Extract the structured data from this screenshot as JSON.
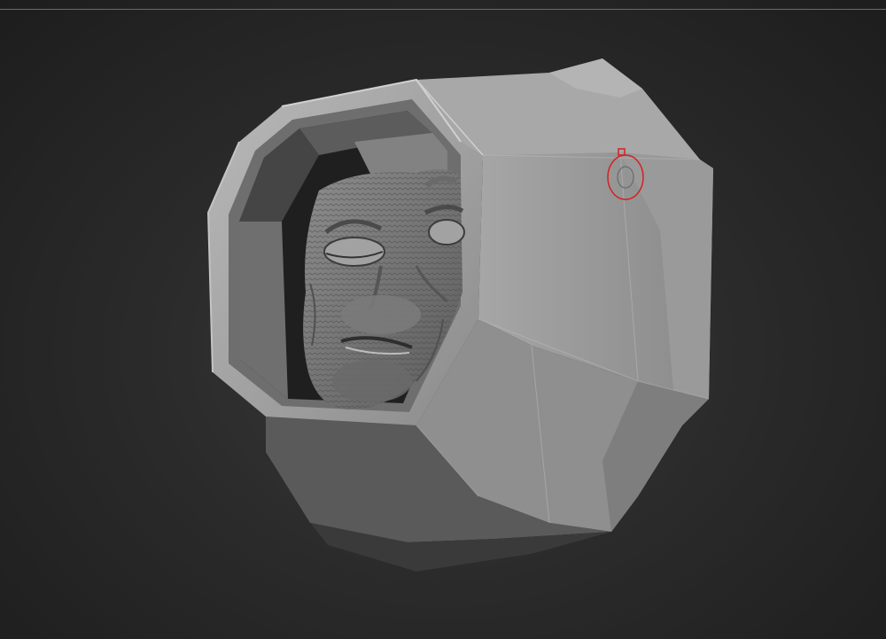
{
  "viewport": {
    "background": "#2b2b2b",
    "mesh_color": "#9a9a9a",
    "brush_cursor_color": "#d42020"
  },
  "model": {
    "name": "",
    "parts": [
      "octagonal-helmet-shell",
      "alien-face-sculpt"
    ]
  }
}
